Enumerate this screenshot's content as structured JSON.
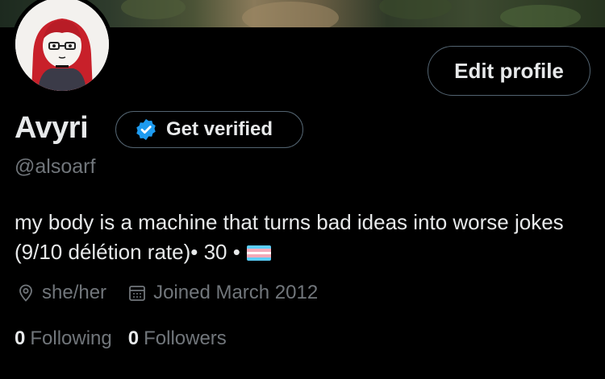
{
  "profile": {
    "display_name": "Avyri",
    "handle": "@alsoarf",
    "bio": "my body is a machine that turns bad ideas into worse jokes (9/10 délétion rate)• 30 •",
    "bio_flag_icon": "trans-flag-icon",
    "pronouns": "she/her",
    "joined": "Joined March 2012"
  },
  "buttons": {
    "edit_profile": "Edit profile",
    "get_verified": "Get verified"
  },
  "stats": {
    "following_count": "0",
    "following_label": "Following",
    "followers_count": "0",
    "followers_label": "Followers"
  },
  "colors": {
    "background": "#000000",
    "text_primary": "#e7e9ea",
    "text_secondary": "#71767b",
    "border": "#536471",
    "verified_blue": "#1d9bf0",
    "flag_blue": "#5bcefa",
    "flag_pink": "#f5a9b8",
    "flag_white": "#ffffff"
  }
}
